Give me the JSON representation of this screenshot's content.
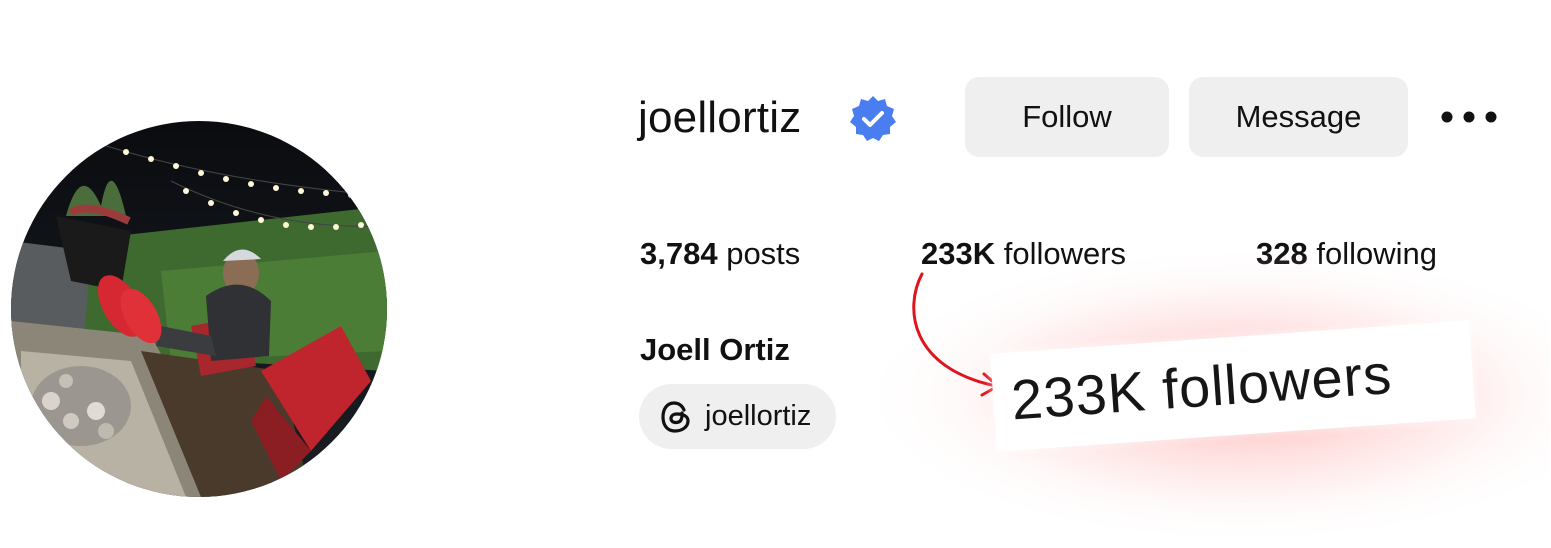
{
  "profile": {
    "username": "joellortiz",
    "verified": true,
    "full_name": "Joell Ortiz",
    "avatar_icon": "profile-photo"
  },
  "actions": {
    "follow_label": "Follow",
    "message_label": "Message",
    "more_icon": "more-options-icon"
  },
  "stats": {
    "posts_count": "3,784",
    "posts_label": "posts",
    "followers_count": "233K",
    "followers_label": "followers",
    "following_count": "328",
    "following_label": "following"
  },
  "threads": {
    "handle": "joellortiz",
    "icon": "threads-icon"
  },
  "annotation": {
    "text": "233K followers",
    "arrow_color": "#e0141e",
    "glow_color": "#ffb3b3"
  },
  "colors": {
    "verified_badge": "#4a7df0",
    "button_bg": "#efefef"
  }
}
